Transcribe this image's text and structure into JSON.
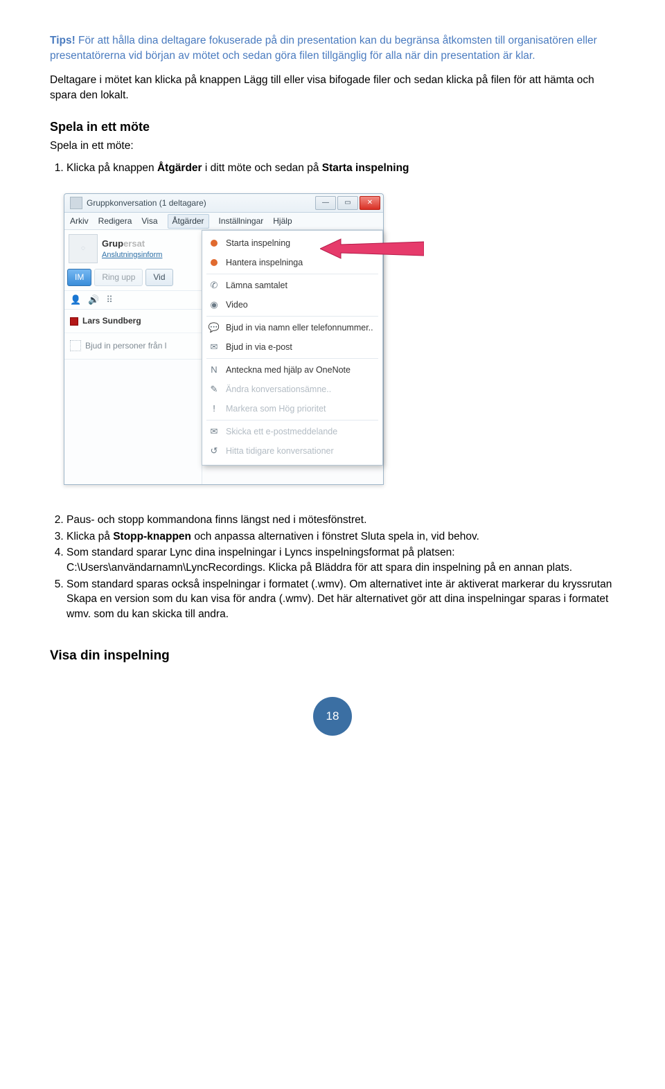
{
  "tips": {
    "label": "Tips!",
    "text": " För att hålla dina deltagare fokuserade på din presentation kan du begränsa åtkomsten till organisatören eller presentatörerna vid början av mötet och sedan göra filen tillgänglig för alla när din presentation är klar."
  },
  "para2": "Deltagare i mötet kan klicka på knappen Lägg till eller visa bifogade filer och sedan klicka på filen för att hämta och spara den lokalt.",
  "sectionTitle": "Spela in ett möte",
  "sectionIntro": "Spela in ett möte:",
  "step1": {
    "pre": "Klicka på knappen ",
    "b1": "Åtgärder",
    "mid": " i ditt möte och sedan på ",
    "b2": "Starta inspelning"
  },
  "window": {
    "title": "Gruppkonversation (1 deltagare)",
    "menus": [
      "Arkiv",
      "Redigera",
      "Visa",
      "Åtgärder",
      "Inställningar",
      "Hjälp"
    ],
    "profileName": "Grup",
    "profileSuffix": "ersat",
    "profileLink": "Anslutningsinform",
    "tabs": [
      "IM",
      "Ring upp",
      "Vid"
    ],
    "toolIcons": [
      "people-icon",
      "audio-icon",
      "dialpad-icon"
    ],
    "presenceName": "Lars Sundberg",
    "inviteText": "Bjud in personer från l",
    "dropdown": [
      {
        "icon": "record-icon",
        "label": "Starta inspelning",
        "enabled": true
      },
      {
        "icon": "record-icon",
        "label": "Hantera inspelninga",
        "enabled": true
      },
      {
        "sep": true
      },
      {
        "icon": "phone-icon",
        "label": "Lämna samtalet",
        "enabled": true
      },
      {
        "icon": "webcam-icon",
        "label": "Video",
        "enabled": true
      },
      {
        "sep": true
      },
      {
        "icon": "chat-icon",
        "label": "Bjud in via namn eller telefonnummer..",
        "enabled": true
      },
      {
        "icon": "mail-icon",
        "label": "Bjud in via e-post",
        "enabled": true
      },
      {
        "sep": true
      },
      {
        "icon": "onenote-icon",
        "label": "Anteckna med hjälp av OneNote",
        "enabled": true
      },
      {
        "icon": "rename-icon",
        "label": "Ändra konversationsämne..",
        "enabled": false
      },
      {
        "icon": "priority-icon",
        "label": "Markera som Hög prioritet",
        "enabled": false
      },
      {
        "sep": true
      },
      {
        "icon": "mail-icon",
        "label": "Skicka ett e-postmeddelande",
        "enabled": false
      },
      {
        "icon": "history-icon",
        "label": "Hitta tidigare konversationer",
        "enabled": false
      }
    ]
  },
  "steps2to5": {
    "s2": "Paus- och stopp kommandona finns längst ned i mötesfönstret.",
    "s3_pre": "Klicka på ",
    "s3_b": "Stopp-knappen",
    "s3_post": " och anpassa alternativen i fönstret Sluta spela in, vid behov.",
    "s4": "Som standard sparar Lync dina inspelningar i Lyncs inspelningsformat på platsen: C:\\Users\\användarnamn\\LyncRecordings. Klicka på Bläddra för att spara din inspelning på en annan plats.",
    "s5": "Som standard sparas också inspelningar i formatet (.wmv). Om alternativet inte är aktiverat markerar du kryssrutan Skapa en version som du kan visa för andra (.wmv). Det här alternativet gör att dina inspelningar sparas i formatet wmv. som du kan skicka till andra."
  },
  "subHeading": "Visa din inspelning",
  "pageNumber": "18"
}
